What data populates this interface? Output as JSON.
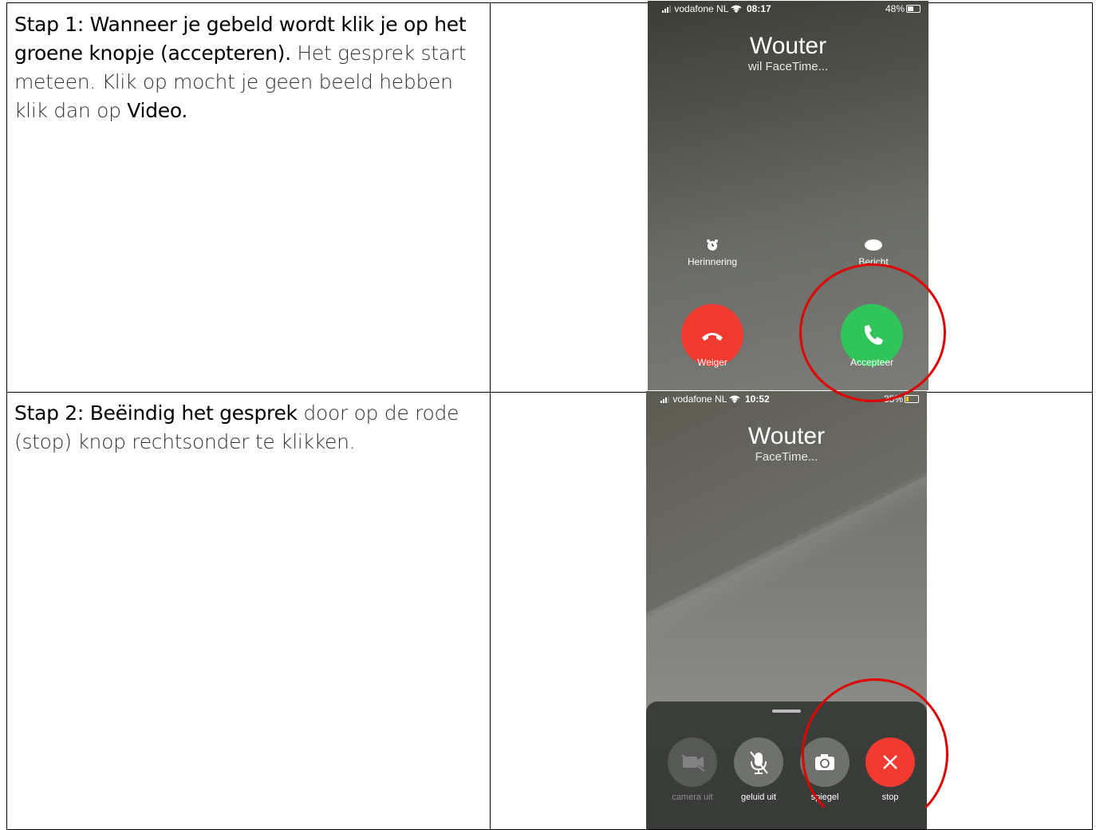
{
  "step1": {
    "bold_part": "Stap 1: Wanneer je gebeld wordt klik je op het groene knopje (accepteren).",
    "text_part": " Het gesprek start meteen. Klik op  mocht je geen beeld hebben klik dan op ",
    "bold_end": "Video.",
    "phone": {
      "carrier": "vodafone NL",
      "time": "08:17",
      "battery": "48%",
      "caller_name": "Wouter",
      "caller_sub": "wil FaceTime...",
      "reminder_label": "Herinnering",
      "message_label": "Bericht",
      "decline_label": "Weiger",
      "accept_label": "Accepteer"
    }
  },
  "step2": {
    "prefix": "Stap 2: ",
    "bold_part": "Beëindig het gesprek",
    "text_part": " door op de rode (stop) knop rechtsonder te klikken.",
    "phone": {
      "carrier": "vodafone NL",
      "time": "10:52",
      "battery": "35%",
      "caller_name": "Wouter",
      "caller_sub": "FaceTime...",
      "camera_label": "camera uit",
      "mute_label": "geluid uit",
      "flip_label": "spiegel",
      "stop_label": "stop"
    }
  },
  "colors": {
    "decline": "#f13a30",
    "accept": "#30c45a",
    "highlight": "#e00000"
  },
  "icons": [
    "alarm-icon",
    "message-bubble-icon",
    "hang-up-icon",
    "phone-icon",
    "camera-off-icon",
    "mic-off-icon",
    "camera-flip-icon",
    "close-icon",
    "wifi-icon",
    "signal-icon",
    "battery-icon"
  ]
}
